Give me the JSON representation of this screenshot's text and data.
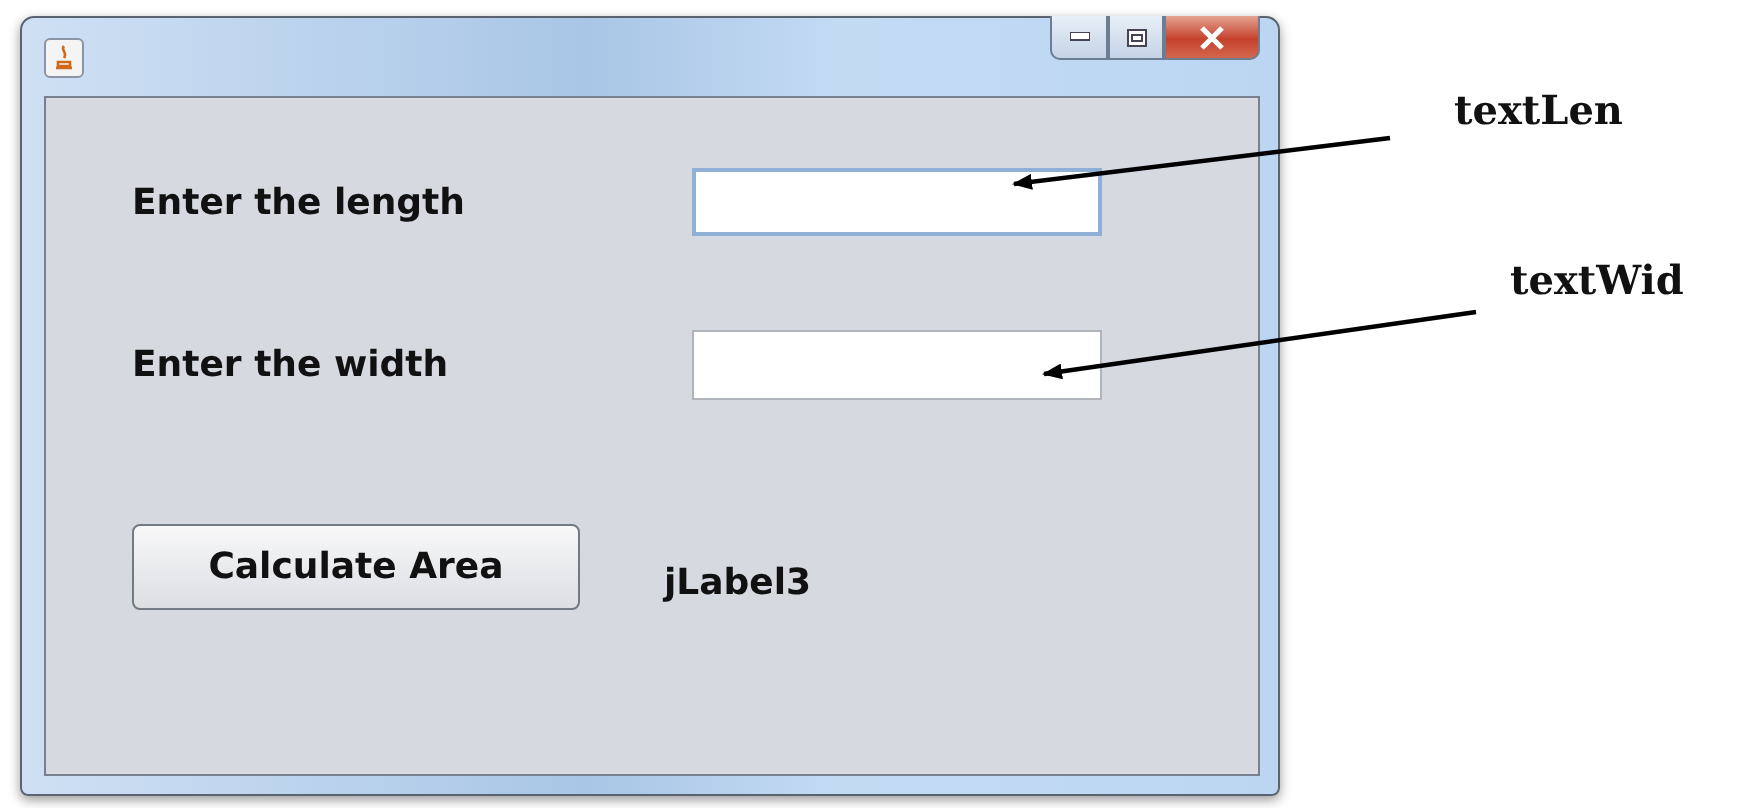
{
  "window": {
    "title_icon": true
  },
  "fields": [
    {
      "label": "Enter the length",
      "focused": true
    },
    {
      "label": "Enter the width",
      "focused": false
    }
  ],
  "button": "Calculate Area",
  "result_label": "jLabel3",
  "annotations": [
    {
      "text": "textLen"
    },
    {
      "text": "textWid"
    }
  ]
}
